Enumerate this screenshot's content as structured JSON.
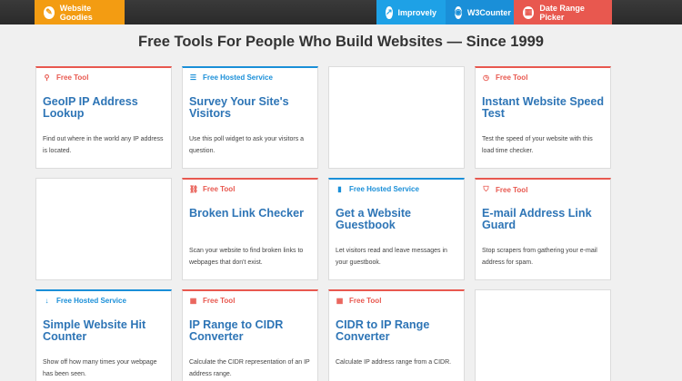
{
  "topbar": {
    "goodies": {
      "label": "Website Goodies",
      "icon": "wand-icon"
    },
    "improvely": {
      "label": "Improvely",
      "icon": "chart-icon"
    },
    "w3counter": {
      "label": "W3Counter",
      "icon": "eye-icon"
    },
    "date_range_picker": {
      "label": "Date Range Picker",
      "icon": "calendar-icon"
    }
  },
  "page": {
    "title": "Free Tools For People Who Build Websites — Since 1999"
  },
  "colors": {
    "free_tool": "#e8584f",
    "hosted_service": "#1a8fd8",
    "goodies": "#f39c12",
    "title_blue": "#2e75b6"
  },
  "cards": [
    {
      "tag": "Free Tool",
      "icon": "map-pin-icon",
      "title": "GeoIP IP Address Lookup",
      "desc": "Find out where in the world any IP address is located."
    },
    {
      "tag": "Free Hosted Service",
      "icon": "list-icon",
      "title": "Survey Your Site's Visitors",
      "desc": "Use this poll widget to ask your visitors a question."
    },
    {
      "tag": "",
      "icon": "",
      "title": "",
      "desc": ""
    },
    {
      "tag": "Free Tool",
      "icon": "clock-icon",
      "title": "Instant Website Speed Test",
      "desc": "Test the speed of your website with this load time checker."
    },
    {
      "tag": "",
      "icon": "",
      "title": "",
      "desc": ""
    },
    {
      "tag": "Free Tool",
      "icon": "broken-link-icon",
      "title": "Broken Link Checker",
      "desc": "Scan your website to find broken links to webpages that don't exist."
    },
    {
      "tag": "Free Hosted Service",
      "icon": "book-icon",
      "title": "Get a Website Guestbook",
      "desc": "Let visitors read and leave messages in your guestbook."
    },
    {
      "tag": "Free Tool",
      "icon": "shield-icon",
      "title": "E-mail Address Link Guard",
      "desc": "Stop scrapers from gathering your e-mail address for spam."
    },
    {
      "tag": "Free Hosted Service",
      "icon": "sort-numeric-icon",
      "title": "Simple Website Hit Counter",
      "desc": "Show off how many times your webpage has been seen."
    },
    {
      "tag": "Free Tool",
      "icon": "calculator-icon",
      "title": "IP Range to CIDR Converter",
      "desc": "Calculate the CIDR representation of an IP address range."
    },
    {
      "tag": "Free Tool",
      "icon": "calculator-icon",
      "title": "CIDR to IP Range Converter",
      "desc": "Calculate IP address range from a CIDR."
    },
    {
      "tag": "",
      "icon": "",
      "title": "",
      "desc": ""
    }
  ]
}
